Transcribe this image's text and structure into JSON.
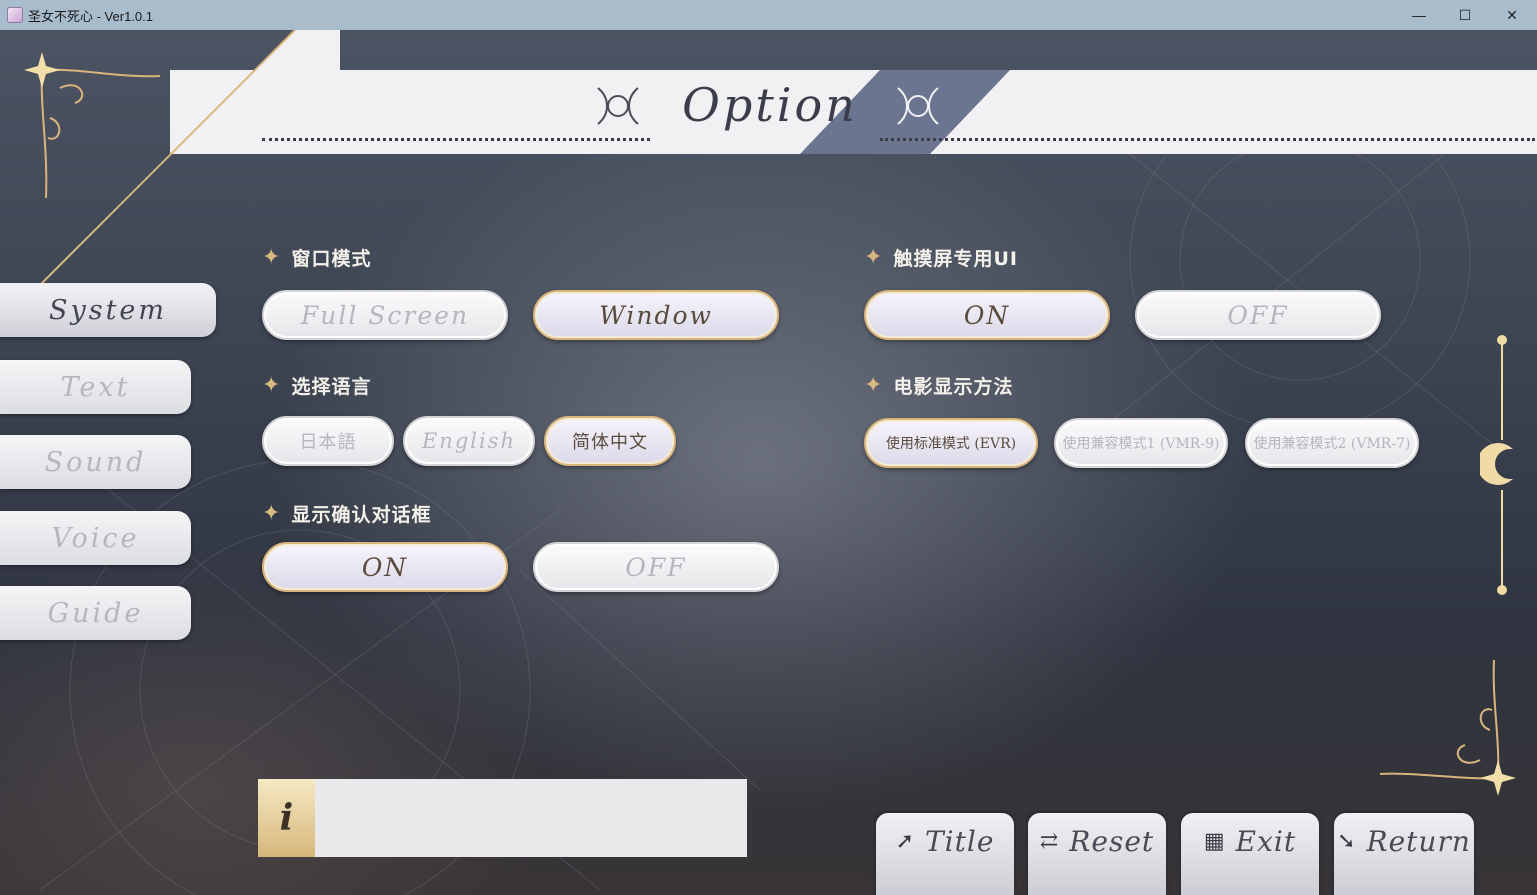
{
  "window": {
    "title": "圣女不死心 - Ver1.0.1",
    "minimize": "—",
    "maximize": "☐",
    "close": "✕"
  },
  "header": {
    "title": "Option"
  },
  "tabs": [
    {
      "label": "System",
      "active": true
    },
    {
      "label": "Text",
      "active": false
    },
    {
      "label": "Sound",
      "active": false
    },
    {
      "label": "Voice",
      "active": false
    },
    {
      "label": "Guide",
      "active": false
    }
  ],
  "sections": {
    "window_mode": {
      "title": "窗口模式",
      "options": [
        {
          "label": "Full Screen",
          "selected": false
        },
        {
          "label": "Window",
          "selected": true
        }
      ]
    },
    "touch_ui": {
      "title": "触摸屏专用UI",
      "options": [
        {
          "label": "ON",
          "selected": true
        },
        {
          "label": "OFF",
          "selected": false
        }
      ]
    },
    "language": {
      "title": "选择语言",
      "options": [
        {
          "label": "日本語",
          "selected": false
        },
        {
          "label": "English",
          "selected": false
        },
        {
          "label": "简体中文",
          "selected": true
        }
      ]
    },
    "movie_mode": {
      "title": "电影显示方法",
      "options": [
        {
          "label": "使用标准模式 (EVR)",
          "selected": true
        },
        {
          "label": "使用兼容模式1 (VMR-9)",
          "selected": false
        },
        {
          "label": "使用兼容模式2 (VMR-7)",
          "selected": false
        }
      ]
    },
    "confirm_dialog": {
      "title": "显示确认对话框",
      "options": [
        {
          "label": "ON",
          "selected": true
        },
        {
          "label": "OFF",
          "selected": false
        }
      ]
    }
  },
  "info": {
    "icon": "i",
    "text": ""
  },
  "bottom_buttons": [
    {
      "label": "Title",
      "icon": "arrow-up-right-icon",
      "glyph": "➚"
    },
    {
      "label": "Reset",
      "icon": "repeat-icon",
      "glyph": "⇄"
    },
    {
      "label": "Exit",
      "icon": "door-icon",
      "glyph": "▦"
    },
    {
      "label": "Return",
      "icon": "arrow-down-left-icon",
      "glyph": "➘"
    }
  ],
  "colors": {
    "accent_gold": "#d9b57c",
    "header_band": "#f1f1f3",
    "header_accent": "#6c7590"
  }
}
